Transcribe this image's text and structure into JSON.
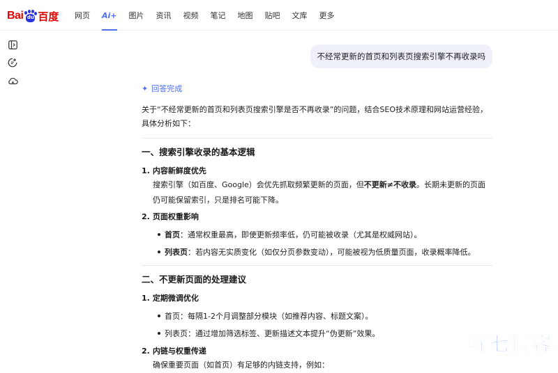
{
  "logo": {
    "bai": "Bai",
    "paw_text": "du",
    "cn": "百度"
  },
  "nav": {
    "items": [
      {
        "label": "网页",
        "active": false
      },
      {
        "label": "Ai+",
        "active": true
      },
      {
        "label": "图片",
        "active": false
      },
      {
        "label": "资讯",
        "active": false
      },
      {
        "label": "视频",
        "active": false
      },
      {
        "label": "笔记",
        "active": false
      },
      {
        "label": "地图",
        "active": false
      },
      {
        "label": "贴吧",
        "active": false
      },
      {
        "label": "文库",
        "active": false
      },
      {
        "label": "更多",
        "active": false
      }
    ]
  },
  "sidebar": {
    "icons": [
      "sidebar-toggle-icon",
      "new-chat-icon",
      "cloud-icon"
    ]
  },
  "user_message": "不经常更新的首页和列表页搜索引擎不再收录吗",
  "answer": {
    "status": "回答完成",
    "intro": "关于“不经常更新的首页和列表页搜索引擎是否不再收录”的问题，结合SEO技术原理和网站运营经验，具体分析如下：",
    "section1": {
      "title": "一、搜索引擎收录的基本逻辑",
      "item1": {
        "num": "1.",
        "title": "内容新鲜度优先",
        "text_a": "搜索引擎（如百度、Google）会优先抓取频繁更新的页面，但",
        "text_bold": "不更新≠不收录",
        "text_b": "。长期未更新的页面仍可能保留索引，只是排名可能下降。"
      },
      "item2": {
        "num": "2.",
        "title": "页面权重影响",
        "bullets": [
          {
            "label": "首页",
            "text": "：通常权重最高，即使更新频率低，仍可能被收录（尤其是权威网站）。"
          },
          {
            "label": "列表页",
            "text": "：若内容无实质变化（如仅分页参数变动），可能被视为低质量页面，收录概率降低。"
          }
        ]
      }
    },
    "section2": {
      "title": "二、不更新页面的处理建议",
      "item1": {
        "num": "1.",
        "title": "定期微调优化",
        "bullets": [
          "首页：每隔1-2个月调整部分模块（如推荐内容、标题文案）。",
          "列表页：通过增加筛选标签、更新描述文本提升“伪更新”效果。"
        ]
      },
      "item2": {
        "num": "2.",
        "title": "内链与权重传递",
        "text": "确保重要页面（如首页）有足够的内链支持，例如："
      }
    }
  },
  "watermark": "吖七博客",
  "colors": {
    "accent": "#4e6ef2",
    "brand_red": "#e10602",
    "brand_blue": "#2932e1",
    "bubble_bg": "#eff1fa",
    "watermark": "#2f63ff"
  }
}
